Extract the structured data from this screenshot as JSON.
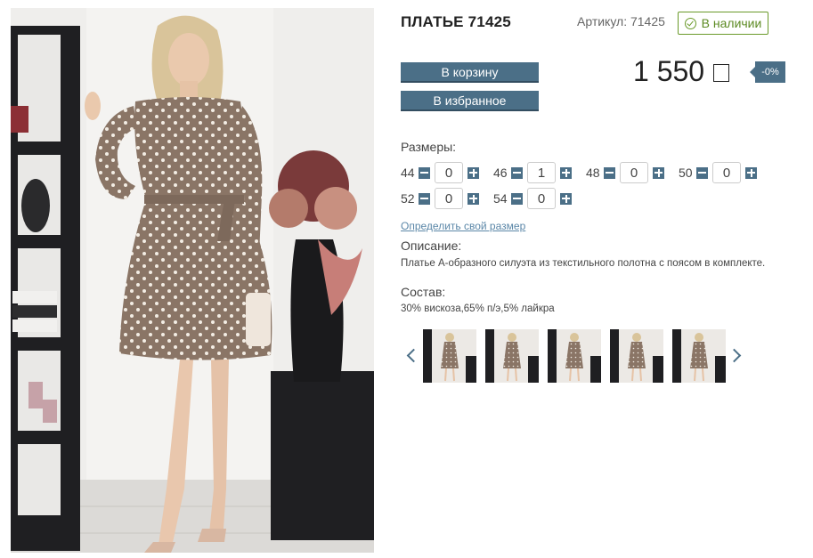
{
  "product": {
    "title": "ПЛАТЬЕ 71425",
    "sku_label": "Артикул: 71425",
    "stock_label": "В наличии",
    "price": "1 550",
    "discount": "-0%"
  },
  "actions": {
    "cart_label": "В корзину",
    "favorite_label": "В избранное"
  },
  "sizes": {
    "label": "Размеры:",
    "items": [
      {
        "size": "44",
        "qty": "0"
      },
      {
        "size": "46",
        "qty": "1"
      },
      {
        "size": "48",
        "qty": "0"
      },
      {
        "size": "50",
        "qty": "0"
      },
      {
        "size": "52",
        "qty": "0"
      },
      {
        "size": "54",
        "qty": "0"
      }
    ],
    "size_guide_link": "Определить свой размер"
  },
  "description": {
    "label": "Описание:",
    "text": "Платье А-образного силуэта из текстильного полотна с поясом в комплекте."
  },
  "composition": {
    "label": "Состав:",
    "text": "30% вискоза,65% п/э,5% лайкра"
  },
  "gallery": {
    "thumb_count": 5
  },
  "colors": {
    "accent": "#4b6f87",
    "stock_green": "#5c8a22",
    "dress": "#8a7566"
  },
  "icons": {
    "stock": "check-circle-icon",
    "minus": "minus-icon",
    "plus": "plus-icon",
    "prev": "chevron-left-icon",
    "next": "chevron-right-icon",
    "currency": "currency-icon"
  }
}
